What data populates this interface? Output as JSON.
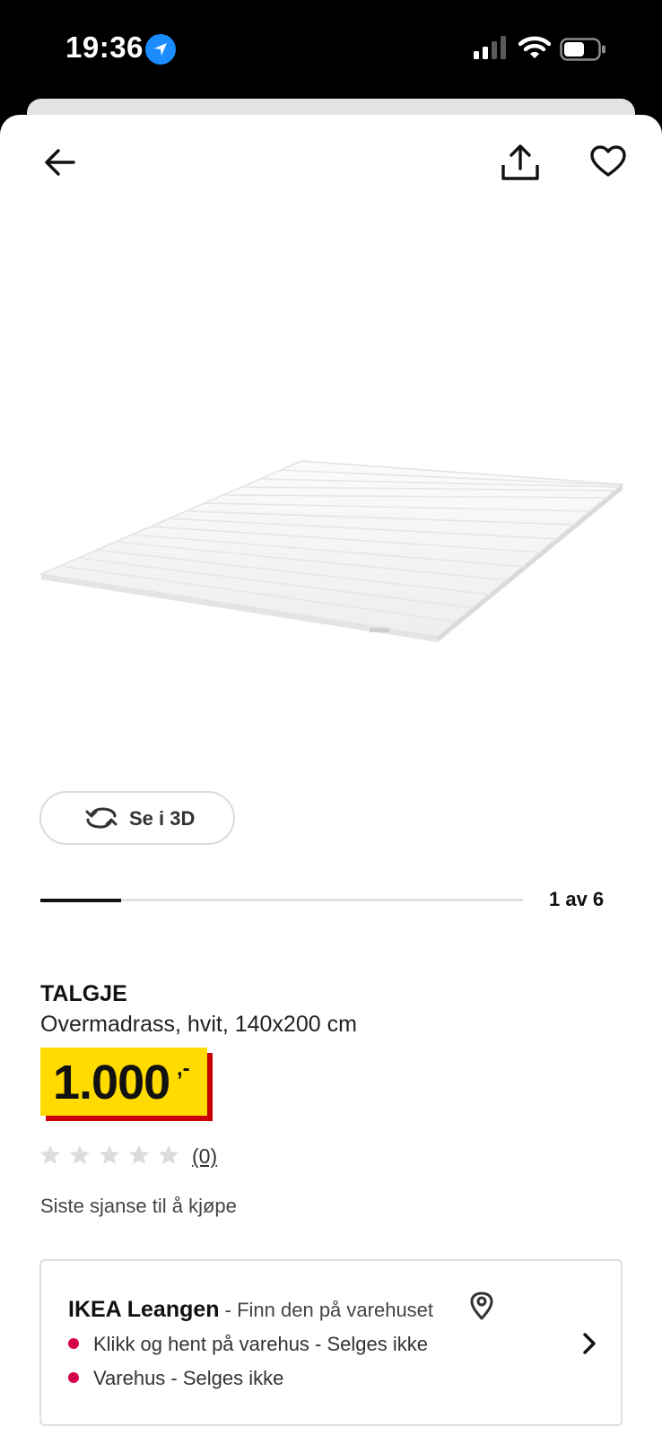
{
  "status_bar": {
    "time": "19:36"
  },
  "header": {
    "back_icon": "arrow-left-icon",
    "share_icon": "share-icon",
    "favorite_icon": "heart-icon"
  },
  "gallery": {
    "view_3d_label": "Se i 3D",
    "counter": "1 av 6",
    "current_index": 1,
    "total": 6
  },
  "product": {
    "name": "TALGJE",
    "description": "Overmadrass, hvit, 140x200 cm",
    "price": "1.000",
    "price_suffix": ",-",
    "rating_count": "(0)",
    "stars_filled": 0,
    "stars_total": 5,
    "stock_note": "Siste sjanse til å kjøpe"
  },
  "store": {
    "name": "IKEA Leangen",
    "hint": " - Finn den på varehuset",
    "availability": [
      {
        "label": "Klikk og hent på varehus - Selges ikke"
      },
      {
        "label": "Varehus - Selges ikke"
      }
    ]
  },
  "colors": {
    "price_bg": "#ffdb00",
    "price_shadow": "#cc0008",
    "unavailable_dot": "#d6004c",
    "location_badge": "#1a8cff"
  }
}
